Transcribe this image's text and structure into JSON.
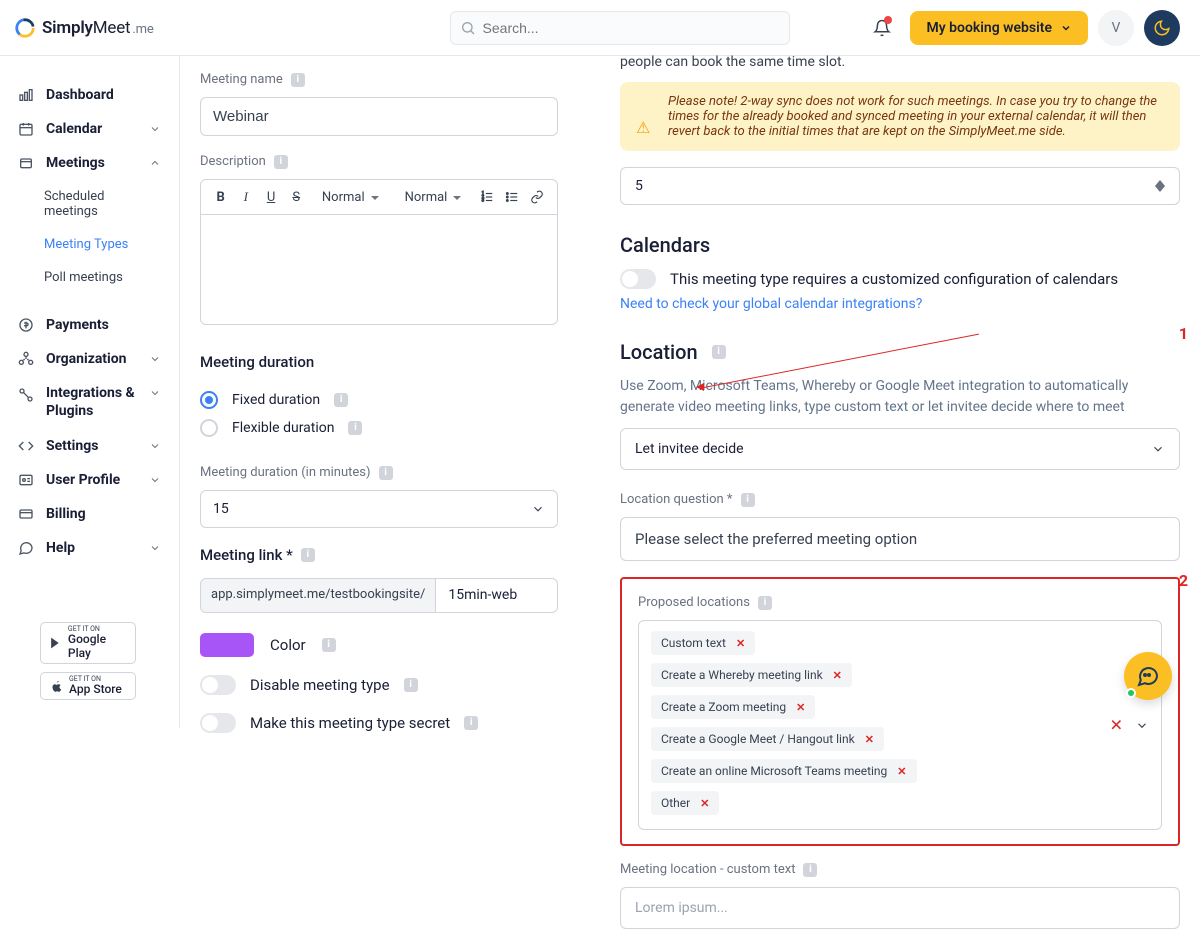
{
  "header": {
    "brand_a": "Simply",
    "brand_b": "Meet",
    "brand_suffix": ".me",
    "search_placeholder": "Search...",
    "booking_label": "My booking website",
    "avatar_initial": "V"
  },
  "sidebar": {
    "dashboard": "Dashboard",
    "calendar": "Calendar",
    "meetings": "Meetings",
    "scheduled": "Scheduled meetings",
    "meeting_types": "Meeting Types",
    "poll": "Poll meetings",
    "payments": "Payments",
    "organization": "Organization",
    "integrations": "Integrations & Plugins",
    "settings": "Settings",
    "user_profile": "User Profile",
    "billing": "Billing",
    "help": "Help",
    "gplay_small": "GET IT ON",
    "gplay_big": "Google Play",
    "appstore_small": "GET IT ON",
    "appstore_big": "App Store"
  },
  "left": {
    "meeting_name_label": "Meeting name",
    "meeting_name_value": "Webinar",
    "description_label": "Description",
    "tb_normal1": "Normal",
    "tb_normal2": "Normal",
    "section_duration": "Meeting duration",
    "fixed_duration": "Fixed duration",
    "flex_duration": "Flexible duration",
    "duration_minutes_label": "Meeting duration (in minutes)",
    "duration_value": "15",
    "link_label": "Meeting link *",
    "link_prefix": "app.simplymeet.me/testbookingsite/",
    "link_value": "15min-web",
    "color_label": "Color",
    "color_hex": "#a855f7",
    "disable_label": "Disable meeting type",
    "secret_label": "Make this meeting type secret"
  },
  "right": {
    "intro": "people can book the same time slot.",
    "note": "Please note! 2-way sync does not work for such meetings. In case you try to change the times for the already booked and synced meeting in your external calendar, it will then revert back to the initial times that are kept on the SimplyMeet.me side.",
    "stepper_value": "5",
    "calendars_heading": "Calendars",
    "calendars_desc": "This meeting type requires a customized configuration of calendars",
    "calendars_link": "Need to check your global calendar integrations?",
    "location_heading": "Location",
    "location_desc": "Use Zoom, Microsoft Teams, Whereby or Google Meet integration to automatically generate video meeting links, type custom text or let invitee decide where to meet",
    "location_selected": "Let invitee decide",
    "location_question_label": "Location question *",
    "location_question_value": "Please select the preferred meeting option",
    "proposed_label": "Proposed locations",
    "pills": {
      "p0": "Custom text",
      "p1": "Create a Whereby meeting link",
      "p2": "Create a Zoom meeting",
      "p3": "Create a Google Meet / Hangout link",
      "p4": "Create an online Microsoft Teams meeting",
      "p5": "Other"
    },
    "custom_text_label": "Meeting location - custom text",
    "custom_text_value": "Lorem ipsum...",
    "annot_1": "1",
    "annot_2": "2"
  }
}
